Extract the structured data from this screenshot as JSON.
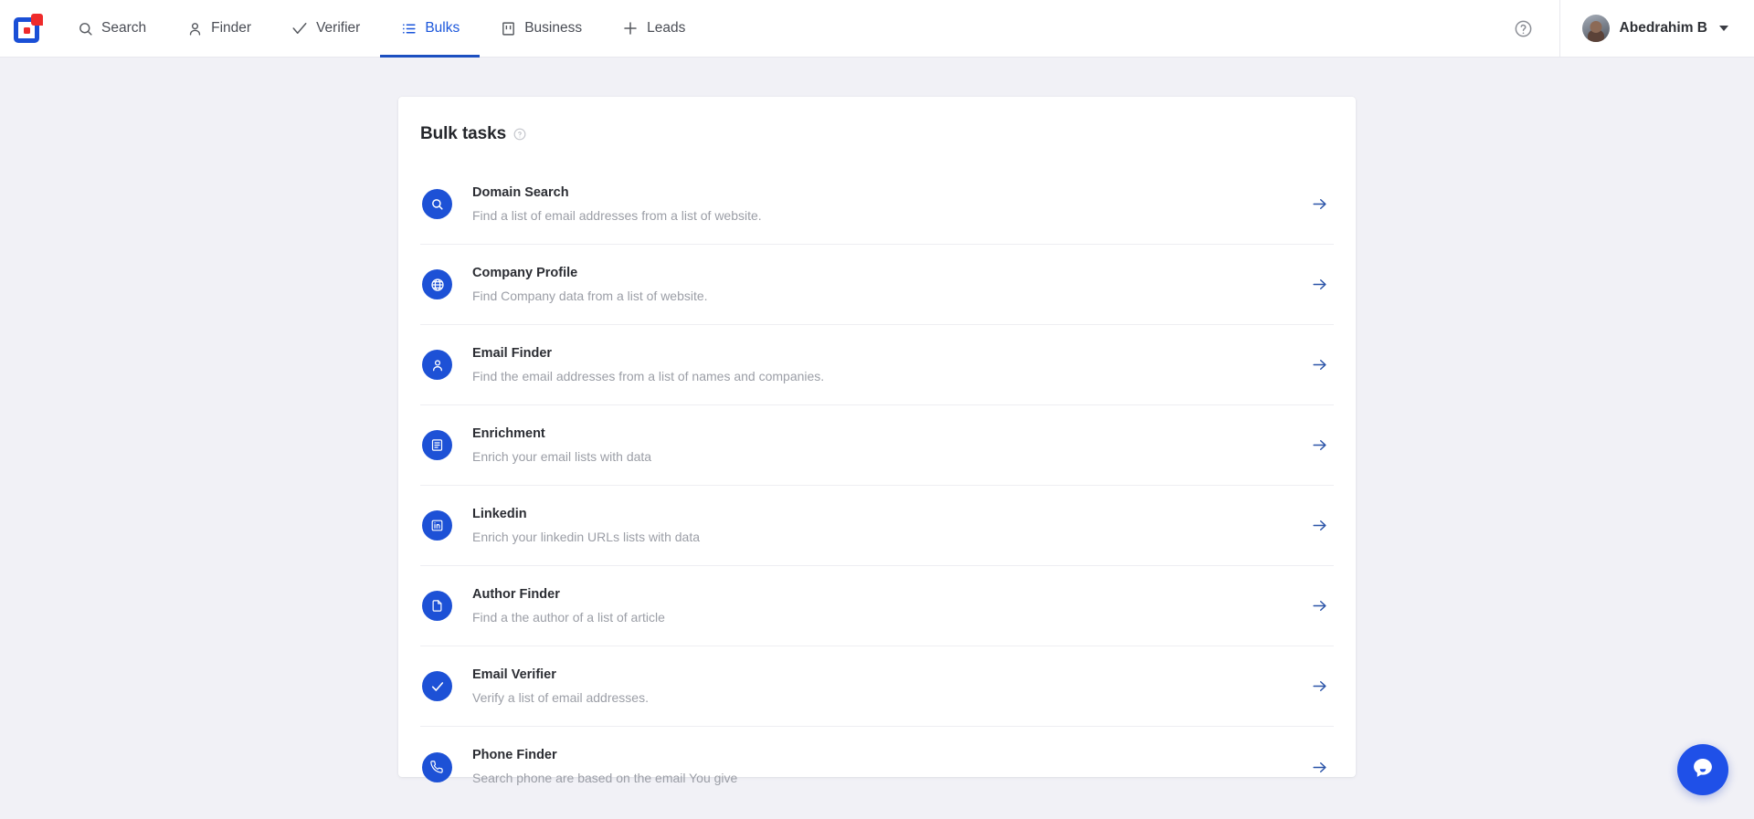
{
  "brand": {
    "logo_name": "app-logo",
    "primary_color": "#1a4fd6",
    "accent_color": "#ef2b2b"
  },
  "topnav": {
    "items": [
      {
        "label": "Search",
        "icon": "search-icon",
        "active": false
      },
      {
        "label": "Finder",
        "icon": "person-icon",
        "active": false
      },
      {
        "label": "Verifier",
        "icon": "check-icon",
        "active": false
      },
      {
        "label": "Bulks",
        "icon": "list-icon",
        "active": true
      },
      {
        "label": "Business",
        "icon": "building-icon",
        "active": false
      },
      {
        "label": "Leads",
        "icon": "plus-icon",
        "active": false
      }
    ],
    "help_icon": "help-circle-icon",
    "user": {
      "name": "Abedrahim B",
      "avatar": "user-avatar",
      "caret": "chevron-down-icon"
    }
  },
  "main": {
    "card": {
      "title": "Bulk tasks",
      "title_info_icon": "info-circle-icon",
      "tasks": [
        {
          "name": "Domain Search",
          "description": "Find a list of email addresses from a list of website.",
          "icon": "search-icon"
        },
        {
          "name": "Company Profile",
          "description": "Find Company data from a list of website.",
          "icon": "globe-icon"
        },
        {
          "name": "Email Finder",
          "description": "Find the email addresses from a list of names and companies.",
          "icon": "person-icon"
        },
        {
          "name": "Enrichment",
          "description": "Enrich your email lists with data",
          "icon": "document-icon"
        },
        {
          "name": "Linkedin",
          "description": "Enrich your linkedin URLs lists with data",
          "icon": "linkedin-icon"
        },
        {
          "name": "Author Finder",
          "description": "Find a the author of a list of article",
          "icon": "file-icon"
        },
        {
          "name": "Email Verifier",
          "description": "Verify a list of email addresses.",
          "icon": "check-icon"
        },
        {
          "name": "Phone Finder",
          "description": "Search phone are based on the email You give",
          "icon": "phone-icon"
        }
      ],
      "row_arrow_icon": "arrow-right-icon"
    }
  },
  "chat_widget": {
    "icon": "chat-bubble-icon",
    "color": "#1f50e8"
  }
}
